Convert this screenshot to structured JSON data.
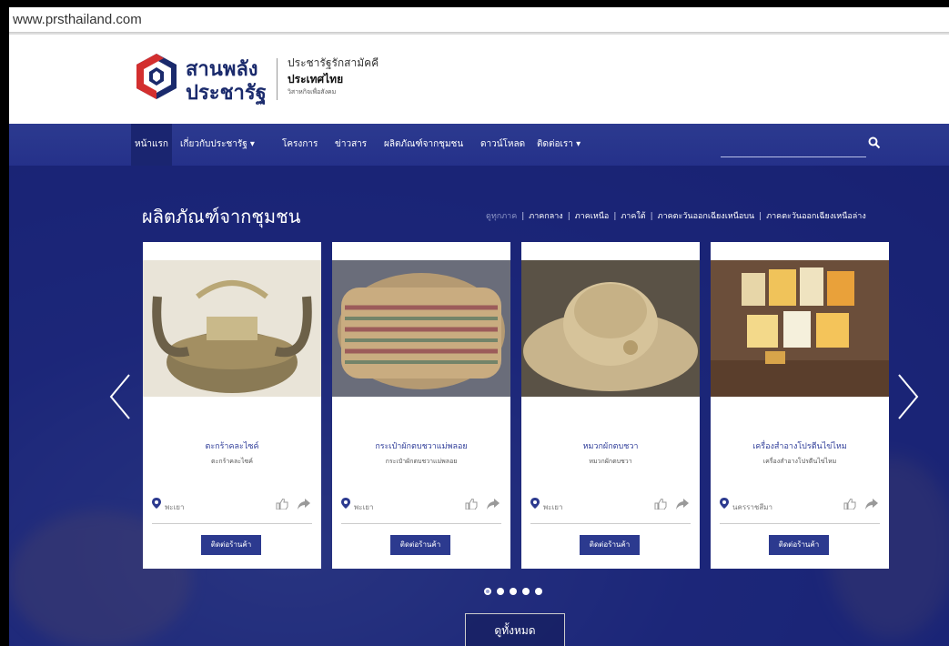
{
  "browser": {
    "url": "www.prsthailand.com"
  },
  "logo": {
    "title_line1": "สานพลัง",
    "title_line2": "ประชารัฐ",
    "sub_line1": "ประชารัฐรักสามัคคี",
    "sub_line2": "ประเทศไทย",
    "sub_line3": "วิสาหกิจเพื่อสังคม",
    "colors": {
      "blue": "#1a2a6c",
      "red": "#d32f2f"
    }
  },
  "nav": {
    "items": [
      {
        "label": "หน้าแรก",
        "active": true
      },
      {
        "label": "เกี่ยวกับประชารัฐ ▾"
      },
      {
        "label": "โครงการ"
      },
      {
        "label": "ข่าวสาร"
      },
      {
        "label": "ผลิตภัณฑ์จากชุมชน"
      },
      {
        "label": "ดาวน์โหลด"
      },
      {
        "label": "ติดต่อเรา ▾"
      }
    ],
    "search_icon": "search-icon"
  },
  "section": {
    "title": "ผลิตภัณฑ์จากชุมชน",
    "regions": [
      "ดูทุกภาค",
      "ภาคกลาง",
      "ภาคเหนือ",
      "ภาคใต้",
      "ภาคตะวันออกเฉียงเหนือบน",
      "ภาคตะวันออกเฉียงเหนือล่าง"
    ]
  },
  "products": [
    {
      "name": "ตะกร้าคละไซค์",
      "desc": "ตะกร้าคละไซค์",
      "location": "พะเยา",
      "button": "ติดต่อร้านค้า"
    },
    {
      "name": "กระเป๋าผักตบชวาแม่พลอย",
      "desc": "กระเป๋าผักตบชวาแม่พลอย",
      "location": "พะเยา",
      "button": "ติดต่อร้านค้า"
    },
    {
      "name": "หมวกผักตบชวา",
      "desc": "หมวกผักตบชวา",
      "location": "พะเยา",
      "button": "ติดต่อร้านค้า"
    },
    {
      "name": "เครื่องสำอางโปรตีนไข่ไหม",
      "desc": "เครื่องสำอางโปรตีนไข่ไหม",
      "location": "นครราชสีมา",
      "button": "ติดต่อร้านค้า"
    }
  ],
  "carousel": {
    "page_count": 5,
    "active_index": 1
  },
  "view_all": "ดูทั้งหมด",
  "colors": {
    "nav_bg": "#2c3a8f",
    "accent": "#2f3d99"
  }
}
